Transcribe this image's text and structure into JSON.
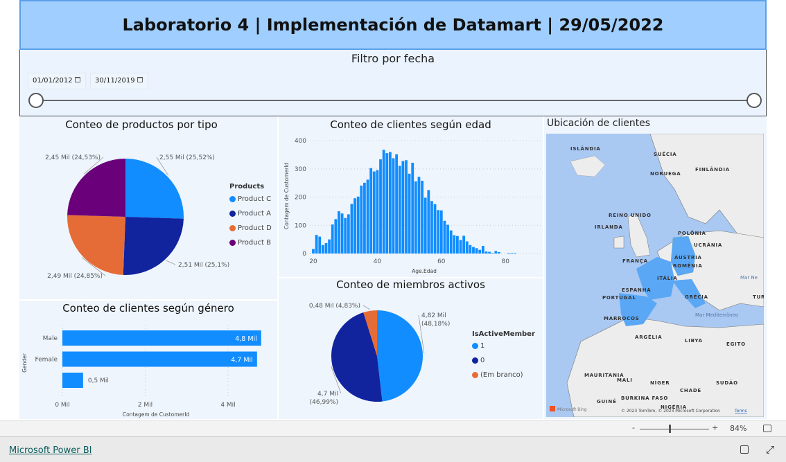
{
  "banner": {
    "title": "Laboratorio 4 | Implementación de Datamart | 29/05/2022"
  },
  "filter": {
    "title": "Filtro por fecha",
    "start_date": "01/01/2012",
    "end_date": "30/11/2019",
    "range": [
      0,
      1
    ]
  },
  "products_chart": {
    "title": "Conteo de productos por tipo",
    "legend_title": "Products",
    "chart_data": {
      "type": "pie",
      "slices": [
        {
          "name": "Product C",
          "value": 2.55,
          "pct": 25.52,
          "label": "2,55 Mil (25,52%)",
          "color": "#118DFF"
        },
        {
          "name": "Product A",
          "value": 2.51,
          "pct": 25.1,
          "label": "2,51 Mil (25,1%)",
          "color": "#12239E"
        },
        {
          "name": "Product D",
          "value": 2.49,
          "pct": 24.85,
          "label": "2,49 Mil (24,85%)",
          "color": "#E66C37"
        },
        {
          "name": "Product B",
          "value": 2.45,
          "pct": 24.53,
          "label": "2,45 Mil (24,53%)",
          "color": "#6B007B"
        }
      ]
    }
  },
  "age_chart": {
    "title": "Conteo de clientes según edad",
    "chart_data": {
      "type": "bar",
      "xlabel": "Age.Edad",
      "ylabel": "Contagem de CustomerId",
      "xticks": [
        "20",
        "40",
        "60",
        "80"
      ],
      "yticks": [
        "0",
        "100",
        "200",
        "300",
        "400"
      ],
      "ylim": [
        0,
        400
      ],
      "xlim": [
        19,
        90
      ],
      "x": [
        20,
        21,
        22,
        23,
        24,
        25,
        26,
        27,
        28,
        29,
        30,
        31,
        32,
        33,
        34,
        35,
        36,
        37,
        38,
        39,
        40,
        41,
        42,
        43,
        44,
        45,
        46,
        47,
        48,
        49,
        50,
        51,
        52,
        53,
        54,
        55,
        56,
        57,
        58,
        59,
        60,
        61,
        62,
        63,
        64,
        65,
        66,
        67,
        68,
        69,
        70,
        71,
        72,
        73,
        74,
        75,
        76,
        77,
        78,
        81,
        82,
        83
      ],
      "values": [
        16,
        66,
        60,
        30,
        37,
        50,
        103,
        122,
        150,
        142,
        126,
        139,
        176,
        196,
        202,
        241,
        251,
        262,
        303,
        291,
        296,
        334,
        368,
        356,
        360,
        338,
        352,
        311,
        328,
        331,
        283,
        322,
        256,
        272,
        258,
        198,
        225,
        186,
        175,
        154,
        153,
        116,
        102,
        82,
        65,
        62,
        48,
        63,
        43,
        30,
        23,
        19,
        13,
        27,
        7,
        6,
        2,
        9,
        5,
        2,
        2,
        2
      ],
      "color": "#118DFF"
    }
  },
  "gender_chart": {
    "title": "Conteo de clientes según género",
    "chart_data": {
      "type": "bar",
      "orientation": "horizontal",
      "xlabel": "Contagem de CustomerId",
      "ylabel": "Gender",
      "categories": [
        "Male",
        "Female",
        ""
      ],
      "values": [
        4.8,
        4.7,
        0.5
      ],
      "data_labels": [
        "4,8 Mil",
        "4,7 Mil",
        "0,5 Mil"
      ],
      "xticks": [
        "0 Mil",
        "2 Mil",
        "4 Mil"
      ],
      "xlim": [
        0,
        4.8
      ],
      "color": "#118DFF"
    }
  },
  "members_chart": {
    "title": "Conteo de miembros activos",
    "legend_title": "IsActiveMember",
    "chart_data": {
      "type": "pie",
      "slices": [
        {
          "name": "1",
          "value": 4.82,
          "pct": 48.18,
          "label": [
            "4,82 Mil",
            "(48,18%)"
          ],
          "color": "#118DFF"
        },
        {
          "name": "0",
          "value": 4.7,
          "pct": 46.99,
          "label": [
            "4,7 Mil",
            "(46,99%)"
          ],
          "color": "#12239E"
        },
        {
          "name": "(Em branco)",
          "value": 0.48,
          "pct": 4.83,
          "label": [
            "0,48 Mil (4,83%)"
          ],
          "color": "#E66C37"
        }
      ]
    }
  },
  "map": {
    "title": "Ubicación de clientes",
    "highlight_color": "#5AA7F5",
    "labels": [
      "ISLÂNDIA",
      "SUÉCIA",
      "FINLÂNDIA",
      "NORUEGA",
      "REINO UNIDO",
      "IRLANDA",
      "POLÔNIA",
      "UCRÂNIA",
      "FRANÇA",
      "ÁUSTRIA",
      "ROMÊNIA",
      "ITÁLIA",
      "ESPANHA",
      "PORTUGAL",
      "GRÉCIA",
      "TUR",
      "MARROCOS",
      "ARGÉLIA",
      "LIBYA",
      "EGITO",
      "MAURITANIA",
      "MALI",
      "NÍGER",
      "CHADE",
      "SUDÃO",
      "BURKINA FASO",
      "GUINÉ",
      "NIGÉRIA"
    ],
    "sea_labels": [
      "Mar Ne",
      "Mar Mediterrâneo"
    ],
    "attribution": "© 2023 TomTom, © 2023 Microsoft Corporation",
    "terms": "Terms",
    "bing": "Microsoft Bing"
  },
  "zoombar": {
    "zoom": "84%",
    "minus": "-",
    "plus": "+",
    "level": 0.42
  },
  "footer": {
    "link": "Microsoft Power BI"
  }
}
